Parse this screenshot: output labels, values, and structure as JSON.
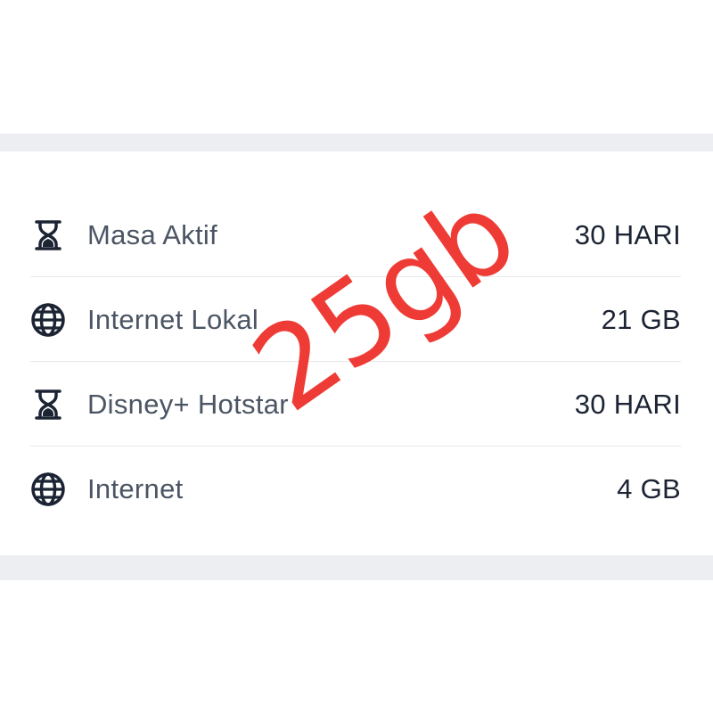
{
  "items": [
    {
      "icon": "hourglass-icon",
      "label": "Masa Aktif",
      "value": "30 HARI"
    },
    {
      "icon": "globe-icon",
      "label": "Internet Lokal",
      "value": "21 GB"
    },
    {
      "icon": "hourglass-icon",
      "label": "Disney+ Hotstar",
      "value": "30 HARI"
    },
    {
      "icon": "globe-icon",
      "label": "Internet",
      "value": "4 GB"
    }
  ],
  "watermark": {
    "text": "25gb"
  },
  "colors": {
    "label": "#4b5563",
    "value": "#1c2433",
    "icon": "#1c2433",
    "band": "#eceef1",
    "divider": "#e6e8eb",
    "watermark": "#ef3b35"
  }
}
